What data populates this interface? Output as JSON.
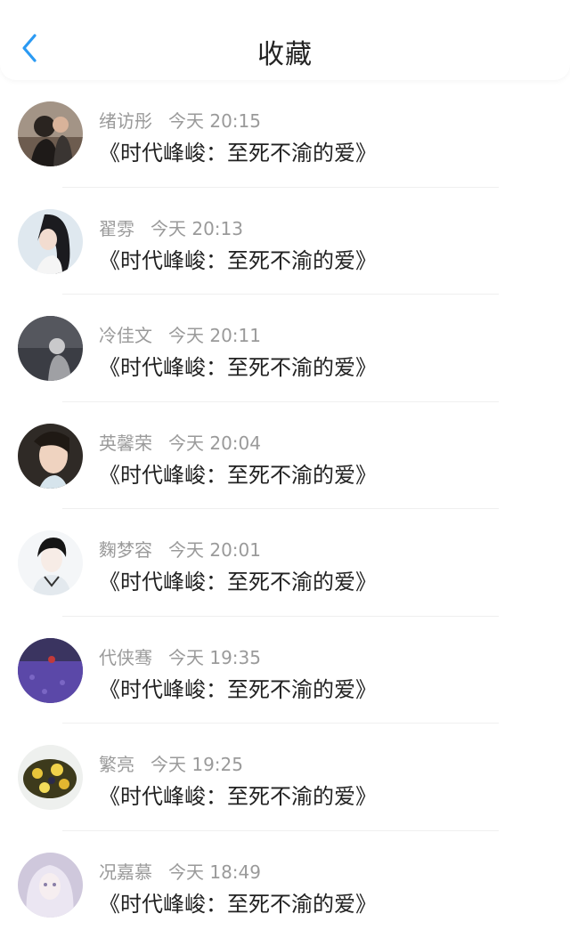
{
  "header": {
    "title": "收藏",
    "back_icon": "chevron-left-icon",
    "accent_color": "#2b9af3"
  },
  "items": [
    {
      "name": "绪访彤",
      "time": "今天 20:15",
      "title": "《时代峰峻：至死不渝的爱》"
    },
    {
      "name": "翟雰",
      "time": "今天 20:13",
      "title": "《时代峰峻：至死不渝的爱》"
    },
    {
      "name": "冷佳文",
      "time": "今天 20:11",
      "title": "《时代峰峻：至死不渝的爱》"
    },
    {
      "name": "英馨荣",
      "time": "今天 20:04",
      "title": "《时代峰峻：至死不渝的爱》"
    },
    {
      "name": "麴梦容",
      "time": "今天 20:01",
      "title": "《时代峰峻：至死不渝的爱》"
    },
    {
      "name": "代侠骞",
      "time": "今天 19:35",
      "title": "《时代峰峻：至死不渝的爱》"
    },
    {
      "name": "繁亮",
      "time": "今天 19:25",
      "title": "《时代峰峻：至死不渝的爱》"
    },
    {
      "name": "况嘉慕",
      "time": "今天 18:49",
      "title": "《时代峰峻：至死不渝的爱》"
    }
  ]
}
